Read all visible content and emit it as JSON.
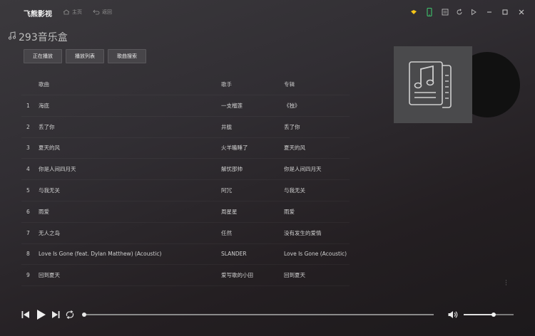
{
  "app": {
    "name": "飞熊影视"
  },
  "nav": {
    "home": "主页",
    "back": "返回"
  },
  "page_title": "293音乐盒",
  "tabs": [
    "正在播放",
    "播放列表",
    "歌曲搜索"
  ],
  "table": {
    "headers": {
      "song": "歌曲",
      "artist": "歌手",
      "album": "专辑"
    },
    "rows": [
      {
        "index": "1",
        "song": "海底",
        "artist": "一支榴莲",
        "album": "《独》"
      },
      {
        "index": "2",
        "song": "丢了你",
        "artist": "井胧",
        "album": "丢了你"
      },
      {
        "index": "3",
        "song": "夏天的风",
        "artist": "火羊瞌睡了",
        "album": "夏天的风"
      },
      {
        "index": "4",
        "song": "你是人间四月天",
        "artist": "解忧邵帅",
        "album": "你是人间四月天"
      },
      {
        "index": "5",
        "song": "与我无关",
        "artist": "阿冗",
        "album": "与我无关"
      },
      {
        "index": "6",
        "song": "雨爱",
        "artist": "周星星",
        "album": "雨爱"
      },
      {
        "index": "7",
        "song": "无人之岛",
        "artist": "任然",
        "album": "没有发生的爱情"
      },
      {
        "index": "8",
        "song": "Love Is Gone (feat. Dylan Matthew) (Acoustic)",
        "artist": "SLANDER",
        "album": "Love Is Gone (Acoustic)"
      },
      {
        "index": "9",
        "song": "回到夏天",
        "artist": "爱写歌的小田",
        "album": "回到夏天"
      }
    ]
  },
  "player": {
    "progress": 0.0,
    "volume": 0.6
  },
  "colors": {
    "accent_yellow": "#f5c518",
    "accent_green": "#3ec46d"
  }
}
